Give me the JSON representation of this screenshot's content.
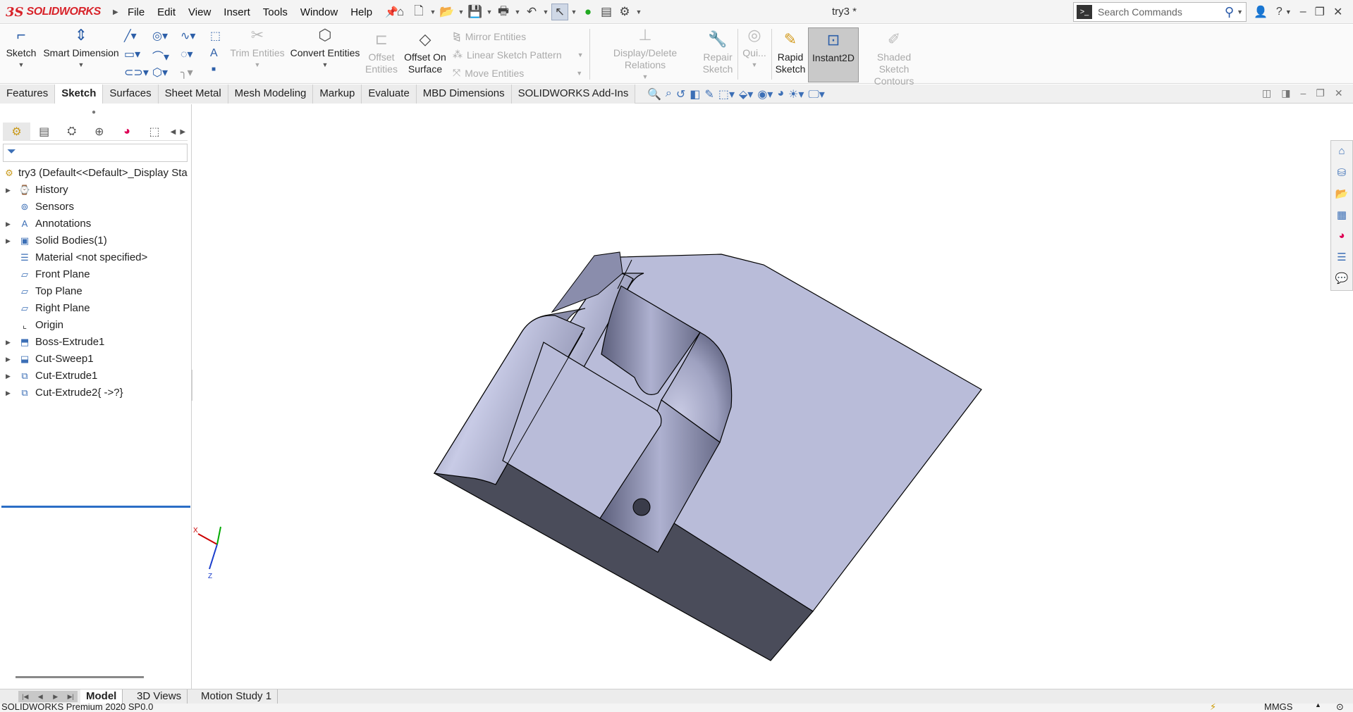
{
  "app": {
    "logo_prefix": "3S",
    "logo_text": "SOLIDWORKS",
    "doc_title": "try3 *"
  },
  "menu": [
    "File",
    "Edit",
    "View",
    "Insert",
    "Tools",
    "Window",
    "Help"
  ],
  "search": {
    "placeholder": "Search Commands"
  },
  "ribbon": {
    "sketch": "Sketch",
    "smart_dimension": "Smart Dimension",
    "trim_entities": "Trim Entities",
    "convert_entities": "Convert Entities",
    "offset_entities_1": "Offset",
    "offset_entities_2": "Entities",
    "offset_on_surface_1": "Offset On",
    "offset_on_surface_2": "Surface",
    "mirror_entities": "Mirror Entities",
    "linear_sketch_pattern": "Linear Sketch Pattern",
    "move_entities": "Move Entities",
    "display_delete_relations": "Display/Delete Relations",
    "repair_sketch_1": "Repair",
    "repair_sketch_2": "Sketch",
    "quick_snaps": "Qui...",
    "rapid_sketch_1": "Rapid",
    "rapid_sketch_2": "Sketch",
    "instant2d": "Instant2D",
    "shaded_sketch_1": "Shaded Sketch",
    "shaded_sketch_2": "Contours"
  },
  "tabs": [
    "Features",
    "Sketch",
    "Surfaces",
    "Sheet Metal",
    "Mesh Modeling",
    "Markup",
    "Evaluate",
    "MBD Dimensions",
    "SOLIDWORKS Add-Ins"
  ],
  "active_tab": "Sketch",
  "tree": {
    "root": "try3  (Default<<Default>_Display Sta",
    "items": [
      {
        "label": "History",
        "expandable": true
      },
      {
        "label": "Sensors",
        "expandable": false
      },
      {
        "label": "Annotations",
        "expandable": true
      },
      {
        "label": "Solid Bodies(1)",
        "expandable": true
      },
      {
        "label": "Material <not specified>",
        "expandable": false
      },
      {
        "label": "Front Plane",
        "expandable": false
      },
      {
        "label": "Top Plane",
        "expandable": false
      },
      {
        "label": "Right Plane",
        "expandable": false
      },
      {
        "label": "Origin",
        "expandable": false
      },
      {
        "label": "Boss-Extrude1",
        "expandable": true
      },
      {
        "label": "Cut-Sweep1",
        "expandable": true
      },
      {
        "label": "Cut-Extrude1",
        "expandable": true
      },
      {
        "label": "Cut-Extrude2{ ->?}",
        "expandable": true
      }
    ]
  },
  "triad": {
    "x": "X",
    "y": "Y",
    "z": "Z"
  },
  "bottom_tabs": [
    "Model",
    "3D Views",
    "Motion Study 1"
  ],
  "status": {
    "left": "SOLIDWORKS Premium 2020 SP0.0",
    "units": "MMGS"
  },
  "colors": {
    "brand": "#d8232a",
    "accent": "#3c6fb6",
    "model_face": "#b9bcd9",
    "model_dark": "#4a4c5a"
  }
}
